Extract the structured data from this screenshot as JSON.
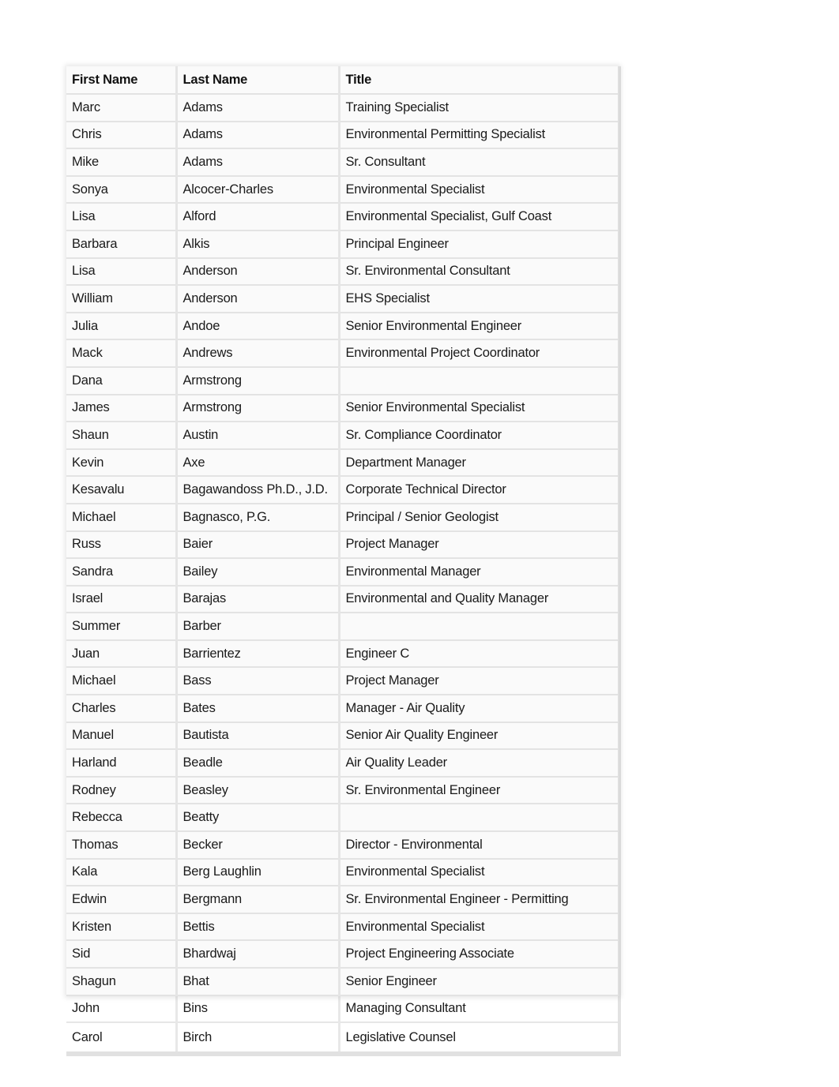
{
  "table": {
    "headers": {
      "first_name": "First Name",
      "last_name": "Last Name",
      "title": "Title"
    },
    "rows": [
      {
        "first": "Marc",
        "last": "Adams",
        "title": "Training Specialist"
      },
      {
        "first": "Chris",
        "last": "Adams",
        "title": "Environmental Permitting Specialist"
      },
      {
        "first": "Mike",
        "last": "Adams",
        "title": "Sr. Consultant"
      },
      {
        "first": "Sonya",
        "last": "Alcocer-Charles",
        "title": "Environmental Specialist"
      },
      {
        "first": "Lisa",
        "last": "Alford",
        "title": "Environmental Specialist, Gulf Coast"
      },
      {
        "first": "Barbara",
        "last": "Alkis",
        "title": "Principal Engineer"
      },
      {
        "first": "Lisa",
        "last": "Anderson",
        "title": "Sr. Environmental Consultant"
      },
      {
        "first": "William",
        "last": "Anderson",
        "title": "EHS Specialist"
      },
      {
        "first": "Julia",
        "last": "Andoe",
        "title": "Senior Environmental Engineer"
      },
      {
        "first": "Mack",
        "last": "Andrews",
        "title": "Environmental Project Coordinator"
      },
      {
        "first": "Dana",
        "last": "Armstrong",
        "title": ""
      },
      {
        "first": "James",
        "last": "Armstrong",
        "title": "Senior Environmental Specialist"
      },
      {
        "first": "Shaun",
        "last": "Austin",
        "title": "Sr. Compliance Coordinator"
      },
      {
        "first": "Kevin",
        "last": "Axe",
        "title": "Department Manager"
      },
      {
        "first": "Kesavalu",
        "last": "Bagawandoss Ph.D., J.D.",
        "title": "Corporate Technical Director"
      },
      {
        "first": "Michael",
        "last": "Bagnasco, P.G.",
        "title": "Principal / Senior Geologist"
      },
      {
        "first": "Russ",
        "last": "Baier",
        "title": "Project Manager"
      },
      {
        "first": "Sandra",
        "last": "Bailey",
        "title": "Environmental Manager"
      },
      {
        "first": "Israel",
        "last": "Barajas",
        "title": "Environmental and Quality Manager"
      },
      {
        "first": "Summer",
        "last": "Barber",
        "title": ""
      },
      {
        "first": "Juan",
        "last": "Barrientez",
        "title": "Engineer C"
      },
      {
        "first": "Michael",
        "last": "Bass",
        "title": "Project Manager"
      },
      {
        "first": "Charles",
        "last": "Bates",
        "title": "Manager - Air Quality"
      },
      {
        "first": "Manuel",
        "last": "Bautista",
        "title": "Senior Air Quality Engineer"
      },
      {
        "first": "Harland",
        "last": "Beadle",
        "title": "Air Quality Leader"
      },
      {
        "first": "Rodney",
        "last": "Beasley",
        "title": "Sr. Environmental Engineer"
      },
      {
        "first": "Rebecca",
        "last": "Beatty",
        "title": ""
      },
      {
        "first": "Thomas",
        "last": "Becker",
        "title": "Director - Environmental"
      },
      {
        "first": "Kala",
        "last": "Berg Laughlin",
        "title": "Environmental Specialist"
      },
      {
        "first": "Edwin",
        "last": "Bergmann",
        "title": "Sr. Environmental Engineer - Permitting"
      },
      {
        "first": "Kristen",
        "last": "Bettis",
        "title": "Environmental Specialist"
      },
      {
        "first": "Sid",
        "last": "Bhardwaj",
        "title": "Project Engineering Associate"
      },
      {
        "first": "Shagun",
        "last": "Bhat",
        "title": "Senior Engineer"
      },
      {
        "first": "John",
        "last": "Bins",
        "title": "Managing Consultant"
      },
      {
        "first": "Carol",
        "last": "Birch",
        "title": "Legislative Counsel"
      }
    ]
  }
}
